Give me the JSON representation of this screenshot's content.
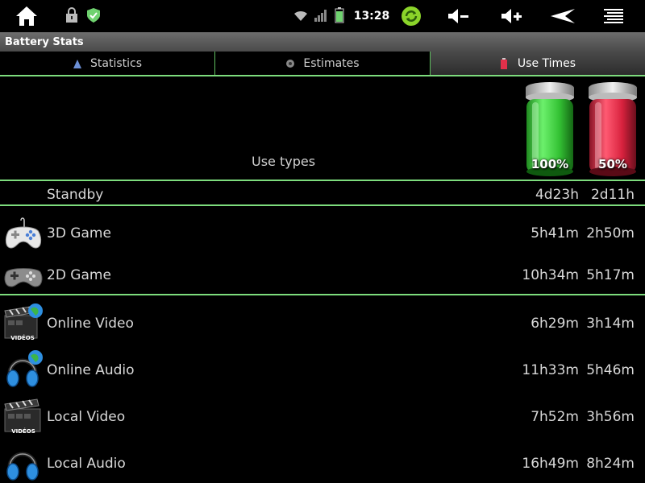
{
  "status_bar": {
    "time": "13:28",
    "icons": [
      "home-icon",
      "lock-icon",
      "shield-icon",
      "wifi-icon",
      "signal-icon",
      "battery-icon",
      "sync-icon",
      "volume-down-icon",
      "volume-up-icon",
      "back-icon",
      "menu-icon"
    ]
  },
  "app": {
    "title": "Battery Stats"
  },
  "tabs": [
    {
      "label": "Statistics",
      "active": false
    },
    {
      "label": "Estimates",
      "active": false
    },
    {
      "label": "Use Times",
      "active": true
    }
  ],
  "header": {
    "use_types_label": "Use types",
    "battery_full_label": "100%",
    "battery_half_label": "50%"
  },
  "rows": [
    {
      "label": "Standby",
      "full": "4d23h",
      "half": "2d11h",
      "icon": "none"
    },
    {
      "label": "3D Game",
      "full": "5h41m",
      "half": "2h50m",
      "icon": "white-gamepad-icon"
    },
    {
      "label": "2D Game",
      "full": "10h34m",
      "half": "5h17m",
      "icon": "grey-gamepad-icon"
    },
    {
      "label": "Online Video",
      "full": "6h29m",
      "half": "3h14m",
      "icon": "video-globe-icon",
      "icon_text": "VIDÉOS"
    },
    {
      "label": "Online Audio",
      "full": "11h33m",
      "half": "5h46m",
      "icon": "headphones-globe-icon"
    },
    {
      "label": "Local Video",
      "full": "7h52m",
      "half": "3h56m",
      "icon": "video-icon",
      "icon_text": "VIDÉOS"
    },
    {
      "label": "Local Audio",
      "full": "16h49m",
      "half": "8h24m",
      "icon": "headphones-icon"
    }
  ],
  "colors": {
    "accent": "#7ddc7d",
    "green_battery": "#3fd23f",
    "red_battery": "#e0304a"
  }
}
